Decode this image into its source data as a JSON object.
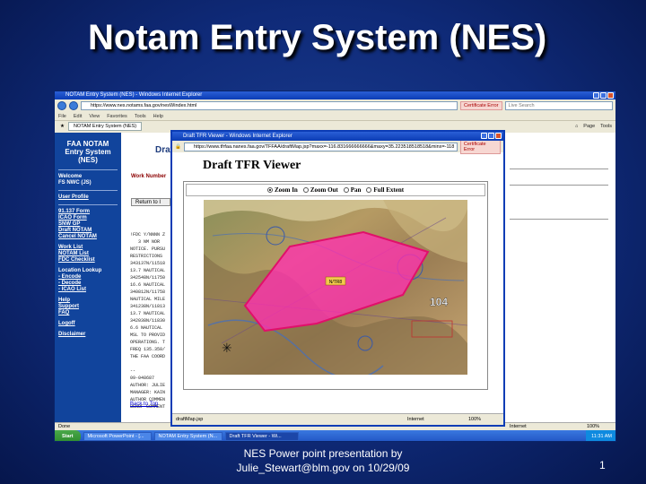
{
  "slide": {
    "title": "Notam Entry System (NES)",
    "footer_line1": "NES Power point presentation by",
    "footer_line2": "Julie_Stewart@blm.gov on 10/29/09",
    "number": "1"
  },
  "main_window": {
    "title": "NOTAM Entry System (NES) - Windows Internet Explorer",
    "address": "https://www.nes.notams.faa.gov/nesWindex.html",
    "certificate": "Certificate Error",
    "search_placeholder": "Live Search",
    "menu": [
      "File",
      "Edit",
      "View",
      "Favorites",
      "Tools",
      "Help"
    ],
    "tab": "NOTAM Entry System (NES)",
    "tools": [
      "Page",
      "Tools"
    ],
    "status_left": "Done",
    "status_net": "Internet",
    "status_zoom": "100%"
  },
  "left_nav": {
    "logo": [
      "FAA NOTAM",
      "Entry System",
      "(NES)"
    ],
    "welcome": [
      "Welcome",
      "FS NWC (JS)"
    ],
    "user_profile": "User Profile",
    "forms": [
      "91.137 Form",
      "ICAO Form",
      "SNW GP",
      "Draft NOTAM",
      "Cancel NOTAM"
    ],
    "lists": [
      "Work List",
      "NOTAM List",
      "FDC Checklist"
    ],
    "location_lookup": "Location Lookup",
    "lookup_items": [
      "- Encode",
      "- Decode",
      "- ICAO List"
    ],
    "help": [
      "Help",
      "Support",
      "FAQ"
    ],
    "logoff": "Logoff",
    "disclaimer": "Disclaimer"
  },
  "page": {
    "heading": "Draft NOT",
    "work_number": "Work Number",
    "return_button": "Return to I",
    "notam_lines": [
      "!FDC Y/NNNN Z",
      "   3 NM NOR",
      "NOTICE. PURSU",
      "RESTRICTIONS",
      "343137N/11518",
      "13.7 NAUTICAL",
      "342548N/11750",
      "16.6 NAUTICAL",
      "340812N/11758",
      "NAUTICAL MILE",
      "341238N/11813",
      "13.7 NAUTICAL",
      "342038N/11830",
      "6.6 NAUTICAL",
      "MSL TO PROVID",
      "OPERATIONS. T",
      "FREQ 135.350/",
      "THE FAA COORD",
      "",
      "--",
      "09-048687",
      "AUTHOR: JULIE",
      "MANAGER: KAIN",
      "AUTHOR COMMEN",
      "USNOF COMMENT"
    ],
    "back_to_top": "Back to Top"
  },
  "taskbar": {
    "start": "Start",
    "tasks": [
      "Microsoft PowerPoint - [...",
      "NOTAM Entry System (N...",
      "Draft TFR Viewer - Wi..."
    ],
    "clock": "11:31 AM"
  },
  "popup": {
    "title": "Draft TFR Viewer - Windows Internet Explorer",
    "address": "https://www.tfrfaa.nanes.faa.gov/TFFAA/draftMap.jsp?maxx=-116.831666666666&maxy=35.223518518518&minx=-118",
    "certificate": "Certificate Error",
    "heading": "Draft TFR Viewer",
    "zoom_options": [
      "Zoom In",
      "Zoom Out",
      "Pan",
      "Full Extent"
    ],
    "selected_zoom": "Zoom In",
    "map_label": "N/TR8",
    "map_badge": "104",
    "status_left": "draftMap.jsp",
    "status_net": "Internet",
    "status_zoom": "100%"
  },
  "colors": {
    "tfr_fill": "#ff2fb0",
    "tfr_stroke": "#e0106a",
    "nav_bg": "#11449c"
  }
}
